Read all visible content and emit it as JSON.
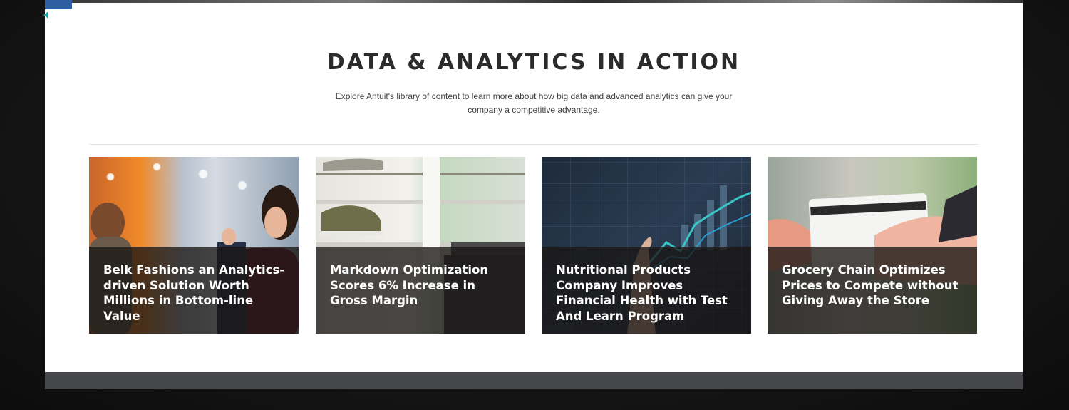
{
  "section": {
    "title": "DATA & ANALYTICS IN ACTION",
    "subtitle_line1": "Explore Antuit's library of content to learn more about how big data and advanced analytics can give your",
    "subtitle_line2": "company a competitive advantage."
  },
  "cards": [
    {
      "caption": "Belk Fashions an Analytics-driven Solution Worth Millions in Bottom-line Value"
    },
    {
      "caption": "Markdown Optimization Scores 6% Increase in Gross Margin"
    },
    {
      "caption": "Nutritional Products Company Improves Financial Health with Test And Learn Program"
    },
    {
      "caption": "Grocery Chain Optimizes Prices to Compete without Giving Away the Store"
    }
  ],
  "colors": {
    "accent_tab": "#2f5fa3",
    "accent_arrow": "#1aa6a6",
    "title_text": "#2b2b2b",
    "caption_overlay": "#191614"
  },
  "icons": [
    "menu-tab-icon",
    "collapse-arrow-icon"
  ]
}
